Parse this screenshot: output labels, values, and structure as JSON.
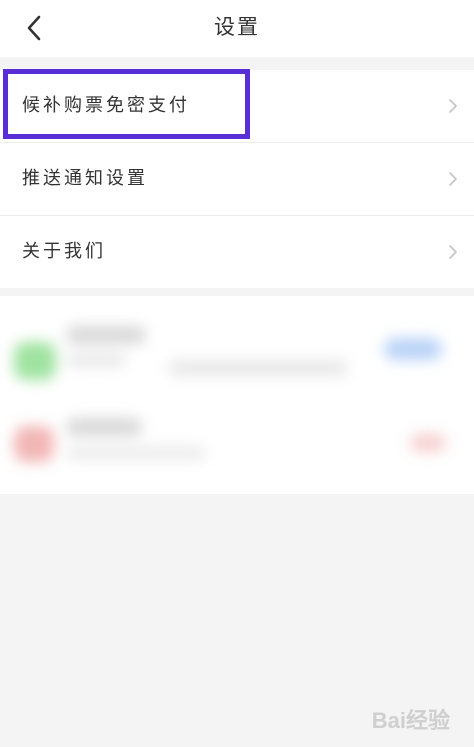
{
  "header": {
    "title": "设置",
    "back_icon": "chevron-left-icon"
  },
  "menu": {
    "items": [
      {
        "label": "候补购票免密支付",
        "icon": "chevron-right-icon"
      },
      {
        "label": "推送通知设置",
        "icon": "chevron-right-icon"
      },
      {
        "label": "关于我们",
        "icon": "chevron-right-icon"
      }
    ]
  },
  "highlight": {
    "color": "#5a2ed6"
  },
  "watermark": {
    "text": "Bai经验"
  }
}
